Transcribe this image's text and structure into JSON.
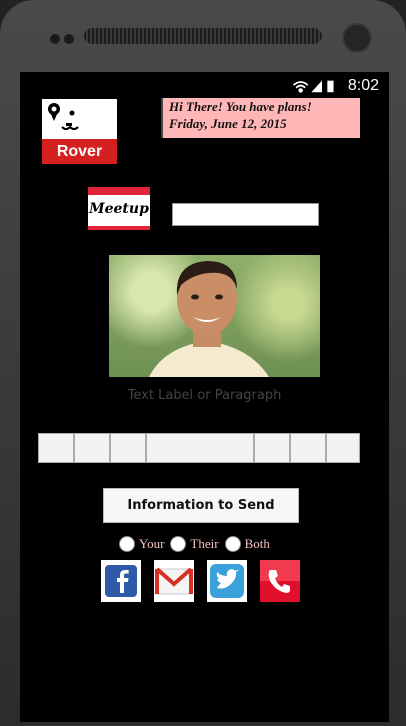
{
  "status": {
    "time": "8:02"
  },
  "logo": {
    "text": "Rover"
  },
  "banner": {
    "line1": "Hi There!  You have plans!",
    "line2": "Friday, June 12, 2015"
  },
  "meetup": {
    "text": "Meetup"
  },
  "name_input": {
    "value": ""
  },
  "label": "Text Label or Paragraph",
  "send_button": "Information to Send",
  "radios": {
    "your": "Your",
    "their": "Their",
    "both": "Both"
  },
  "social": [
    "facebook-icon",
    "gmail-icon",
    "twitter-icon",
    "phone-icon"
  ],
  "colors": {
    "banner": "#ffb6b6",
    "rover": "#d42020",
    "meetup": "#e0253b"
  }
}
